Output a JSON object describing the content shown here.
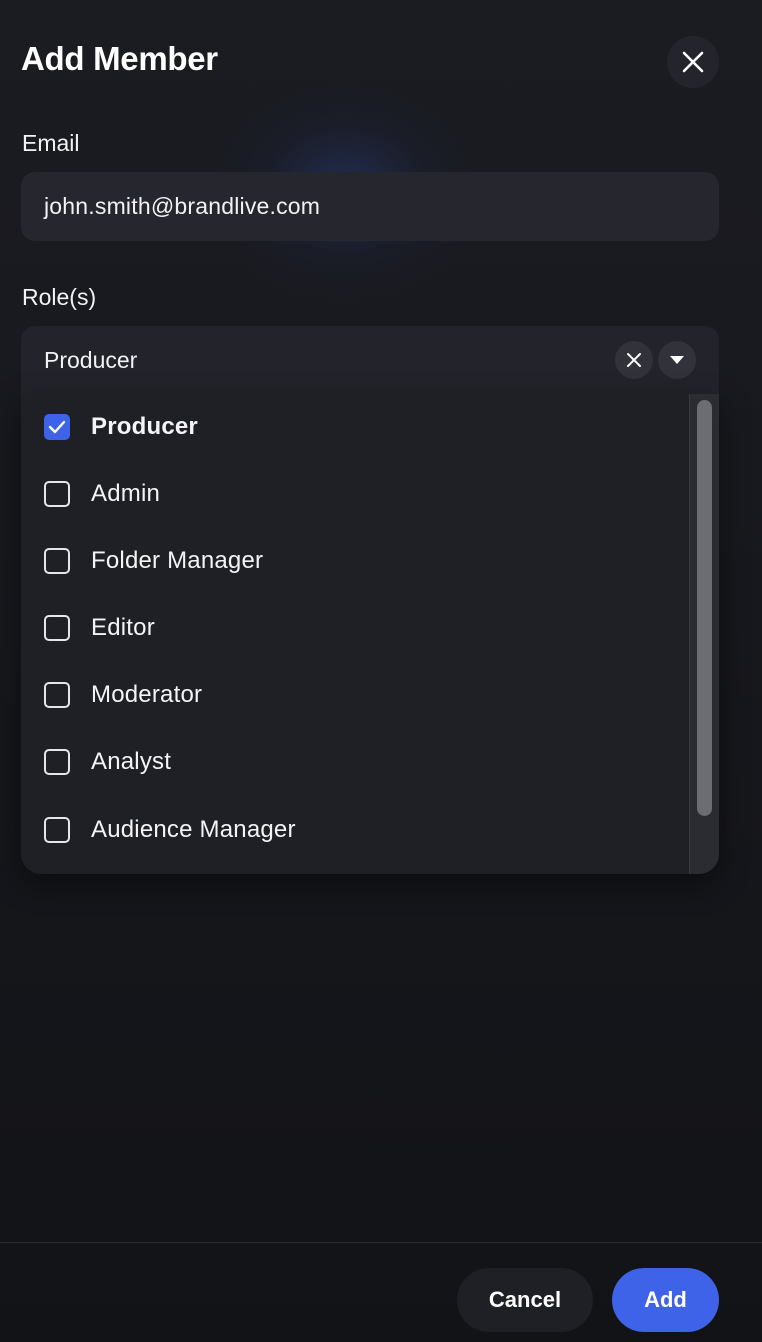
{
  "modal": {
    "title": "Add Member",
    "close_icon": "close-icon"
  },
  "email": {
    "label": "Email",
    "value": "john.smith@brandlive.com"
  },
  "roles": {
    "label": "Role(s)",
    "selected_value": "Producer",
    "clear_icon": "close-icon",
    "dropdown_icon": "caret-down-icon",
    "options": [
      {
        "label": "Producer",
        "checked": true
      },
      {
        "label": "Admin",
        "checked": false
      },
      {
        "label": "Folder Manager",
        "checked": false
      },
      {
        "label": "Editor",
        "checked": false
      },
      {
        "label": "Moderator",
        "checked": false
      },
      {
        "label": "Analyst",
        "checked": false
      },
      {
        "label": "Audience Manager",
        "checked": false
      }
    ]
  },
  "footer": {
    "cancel_label": "Cancel",
    "add_label": "Add"
  },
  "colors": {
    "accent": "#3f63e8",
    "background": "#17181d",
    "input_bg": "#26272e"
  }
}
